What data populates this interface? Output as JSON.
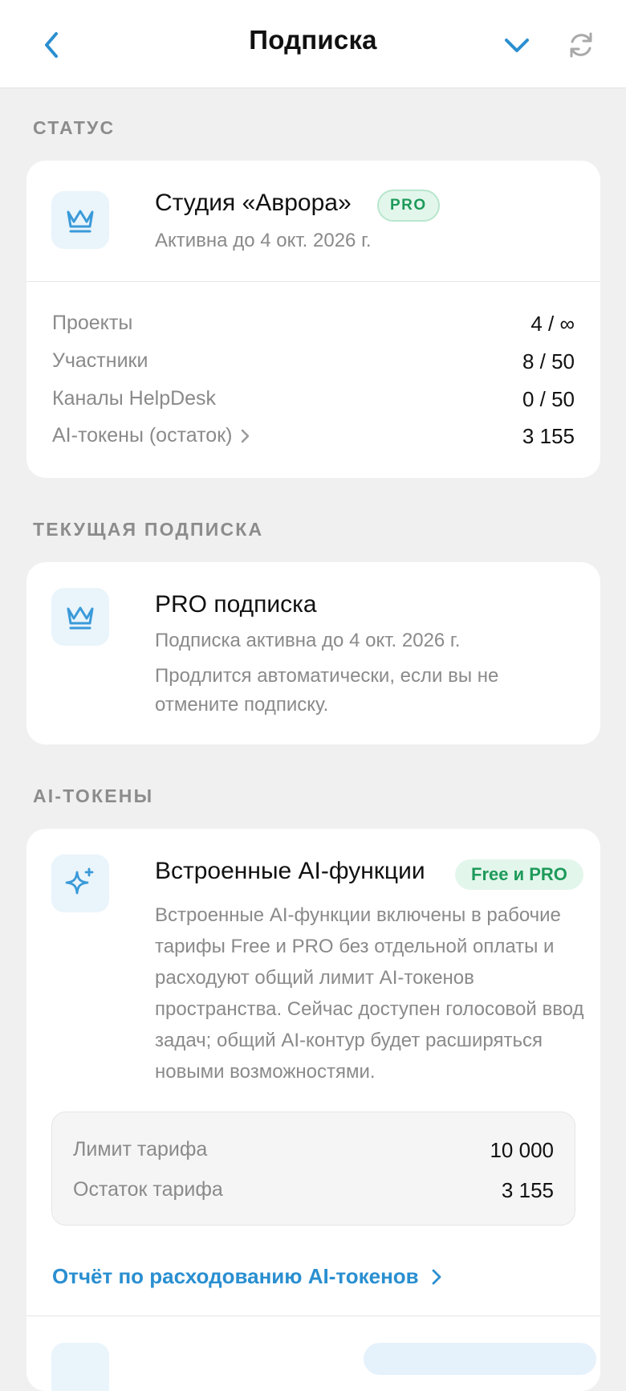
{
  "header": {
    "title": "Подписка",
    "icons": {
      "back": "chevron-left-icon",
      "dropdown": "chevron-down-icon",
      "refresh": "refresh-icon"
    }
  },
  "colors": {
    "accent": "#2a8fd0",
    "badge_green": "#1e9a5a",
    "background": "#f0f0f0"
  },
  "status": {
    "section_title": "СТАТУС",
    "org_name": "Студия «Аврора»",
    "badge": "PRO",
    "active_until": "Активна до 4 окт. 2026 г.",
    "icon": "crown-icon",
    "stats": [
      {
        "label": "Проекты",
        "value": "4 / ∞"
      },
      {
        "label": "Участники",
        "value": "8 / 50"
      },
      {
        "label": "Каналы HelpDesk",
        "value": "0 / 50"
      },
      {
        "label": "AI-токены (остаток)",
        "value": "3 155"
      }
    ]
  },
  "current_subscription": {
    "section_title": "ТЕКУЩАЯ ПОДПИСКА",
    "title": "PRO подписка",
    "active_until": "Подписка активна до 4 окт. 2026 г.",
    "note": "Продлится автоматически, если вы не отмените подписку.",
    "icon": "crown-icon"
  },
  "ai_tokens": {
    "section_title": "AI-ТОКЕНЫ",
    "builtin": {
      "title": "Встроенные AI-функции",
      "badge": "Free и PRO",
      "icon": "sparkle-icon",
      "description": "Встроенные AI-функции включены в рабочие тарифы Free и PRO без отдельной оплаты и расходуют общий лимит AI-токенов пространства. Сейчас доступен голосовой ввод задач; общий AI-контур будет расширяться новыми возможностями."
    },
    "limits": [
      {
        "label": "Лимит тарифа",
        "value": "10 000"
      },
      {
        "label": "Остаток тарифа",
        "value": "3 155"
      }
    ],
    "report_link": "Отчёт по расходованию AI-токенов"
  }
}
